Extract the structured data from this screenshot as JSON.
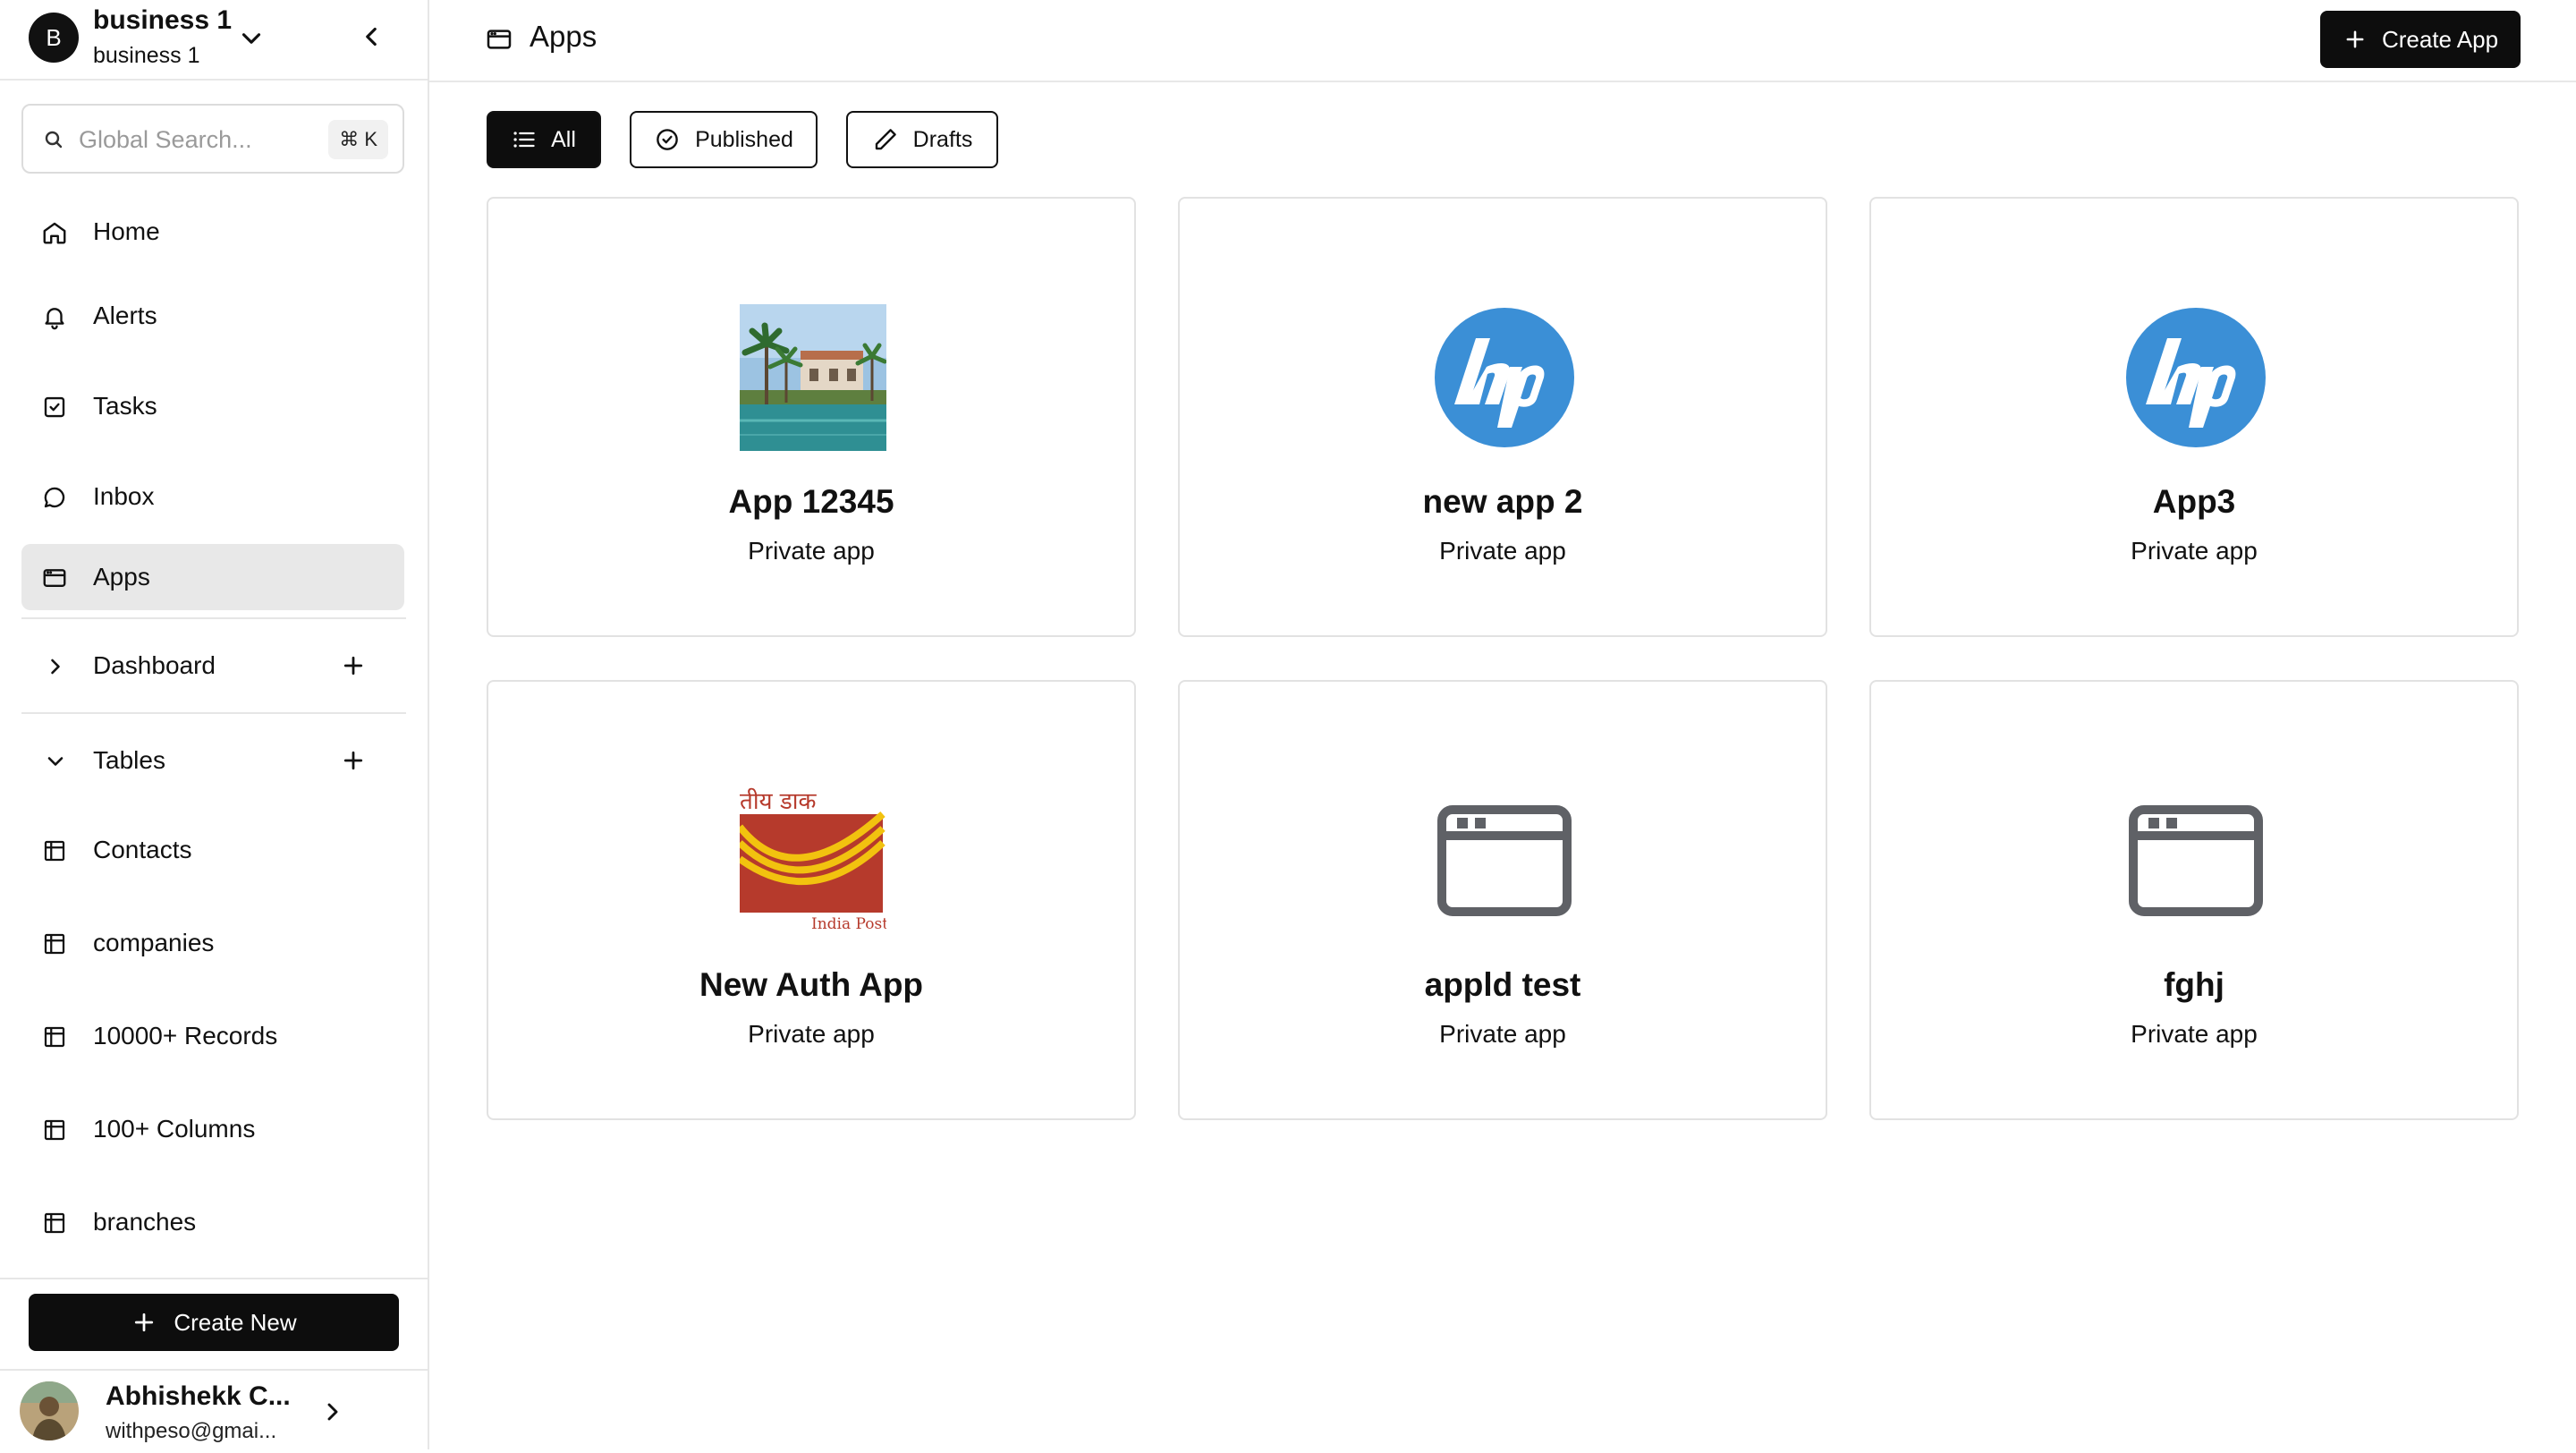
{
  "workspace": {
    "initial": "B",
    "name": "business 1",
    "subtitle": "business 1"
  },
  "search": {
    "placeholder": "Global Search...",
    "shortcut": "⌘ K"
  },
  "nav": {
    "home": "Home",
    "alerts": "Alerts",
    "tasks": "Tasks",
    "inbox": "Inbox",
    "apps": "Apps"
  },
  "sections": {
    "dashboard": "Dashboard",
    "tables": "Tables"
  },
  "tables": [
    {
      "label": "Contacts"
    },
    {
      "label": "companies"
    },
    {
      "label": "10000+ Records"
    },
    {
      "label": "100+ Columns"
    },
    {
      "label": "branches"
    }
  ],
  "sidebar_footer": {
    "create_new": "Create New",
    "user_name": "Abhishekk C...",
    "user_email": "withpeso@gmai..."
  },
  "header": {
    "title": "Apps",
    "create_app": "Create App"
  },
  "filters": {
    "all": "All",
    "published": "Published",
    "drafts": "Drafts",
    "active": "All"
  },
  "apps": [
    {
      "name": "App 12345",
      "visibility": "Private app",
      "icon": "resort-photo"
    },
    {
      "name": "new app 2",
      "visibility": "Private app",
      "icon": "hp-logo"
    },
    {
      "name": "App3",
      "visibility": "Private app",
      "icon": "hp-logo"
    },
    {
      "name": "New Auth App",
      "visibility": "Private app",
      "icon": "india-post-logo",
      "logo_text": "तीय डाक",
      "logo_caption": "India Post"
    },
    {
      "name": "appld test",
      "visibility": "Private app",
      "icon": "browser-window-icon"
    },
    {
      "name": "fghj",
      "visibility": "Private app",
      "icon": "browser-window-icon"
    }
  ],
  "colors": {
    "primary": "#0d0d0d",
    "active_nav": "#e8e8e8",
    "hp_blue": "#3b8fd6",
    "india_post_red": "#b63a2c",
    "india_post_yellow": "#f2c20f"
  }
}
